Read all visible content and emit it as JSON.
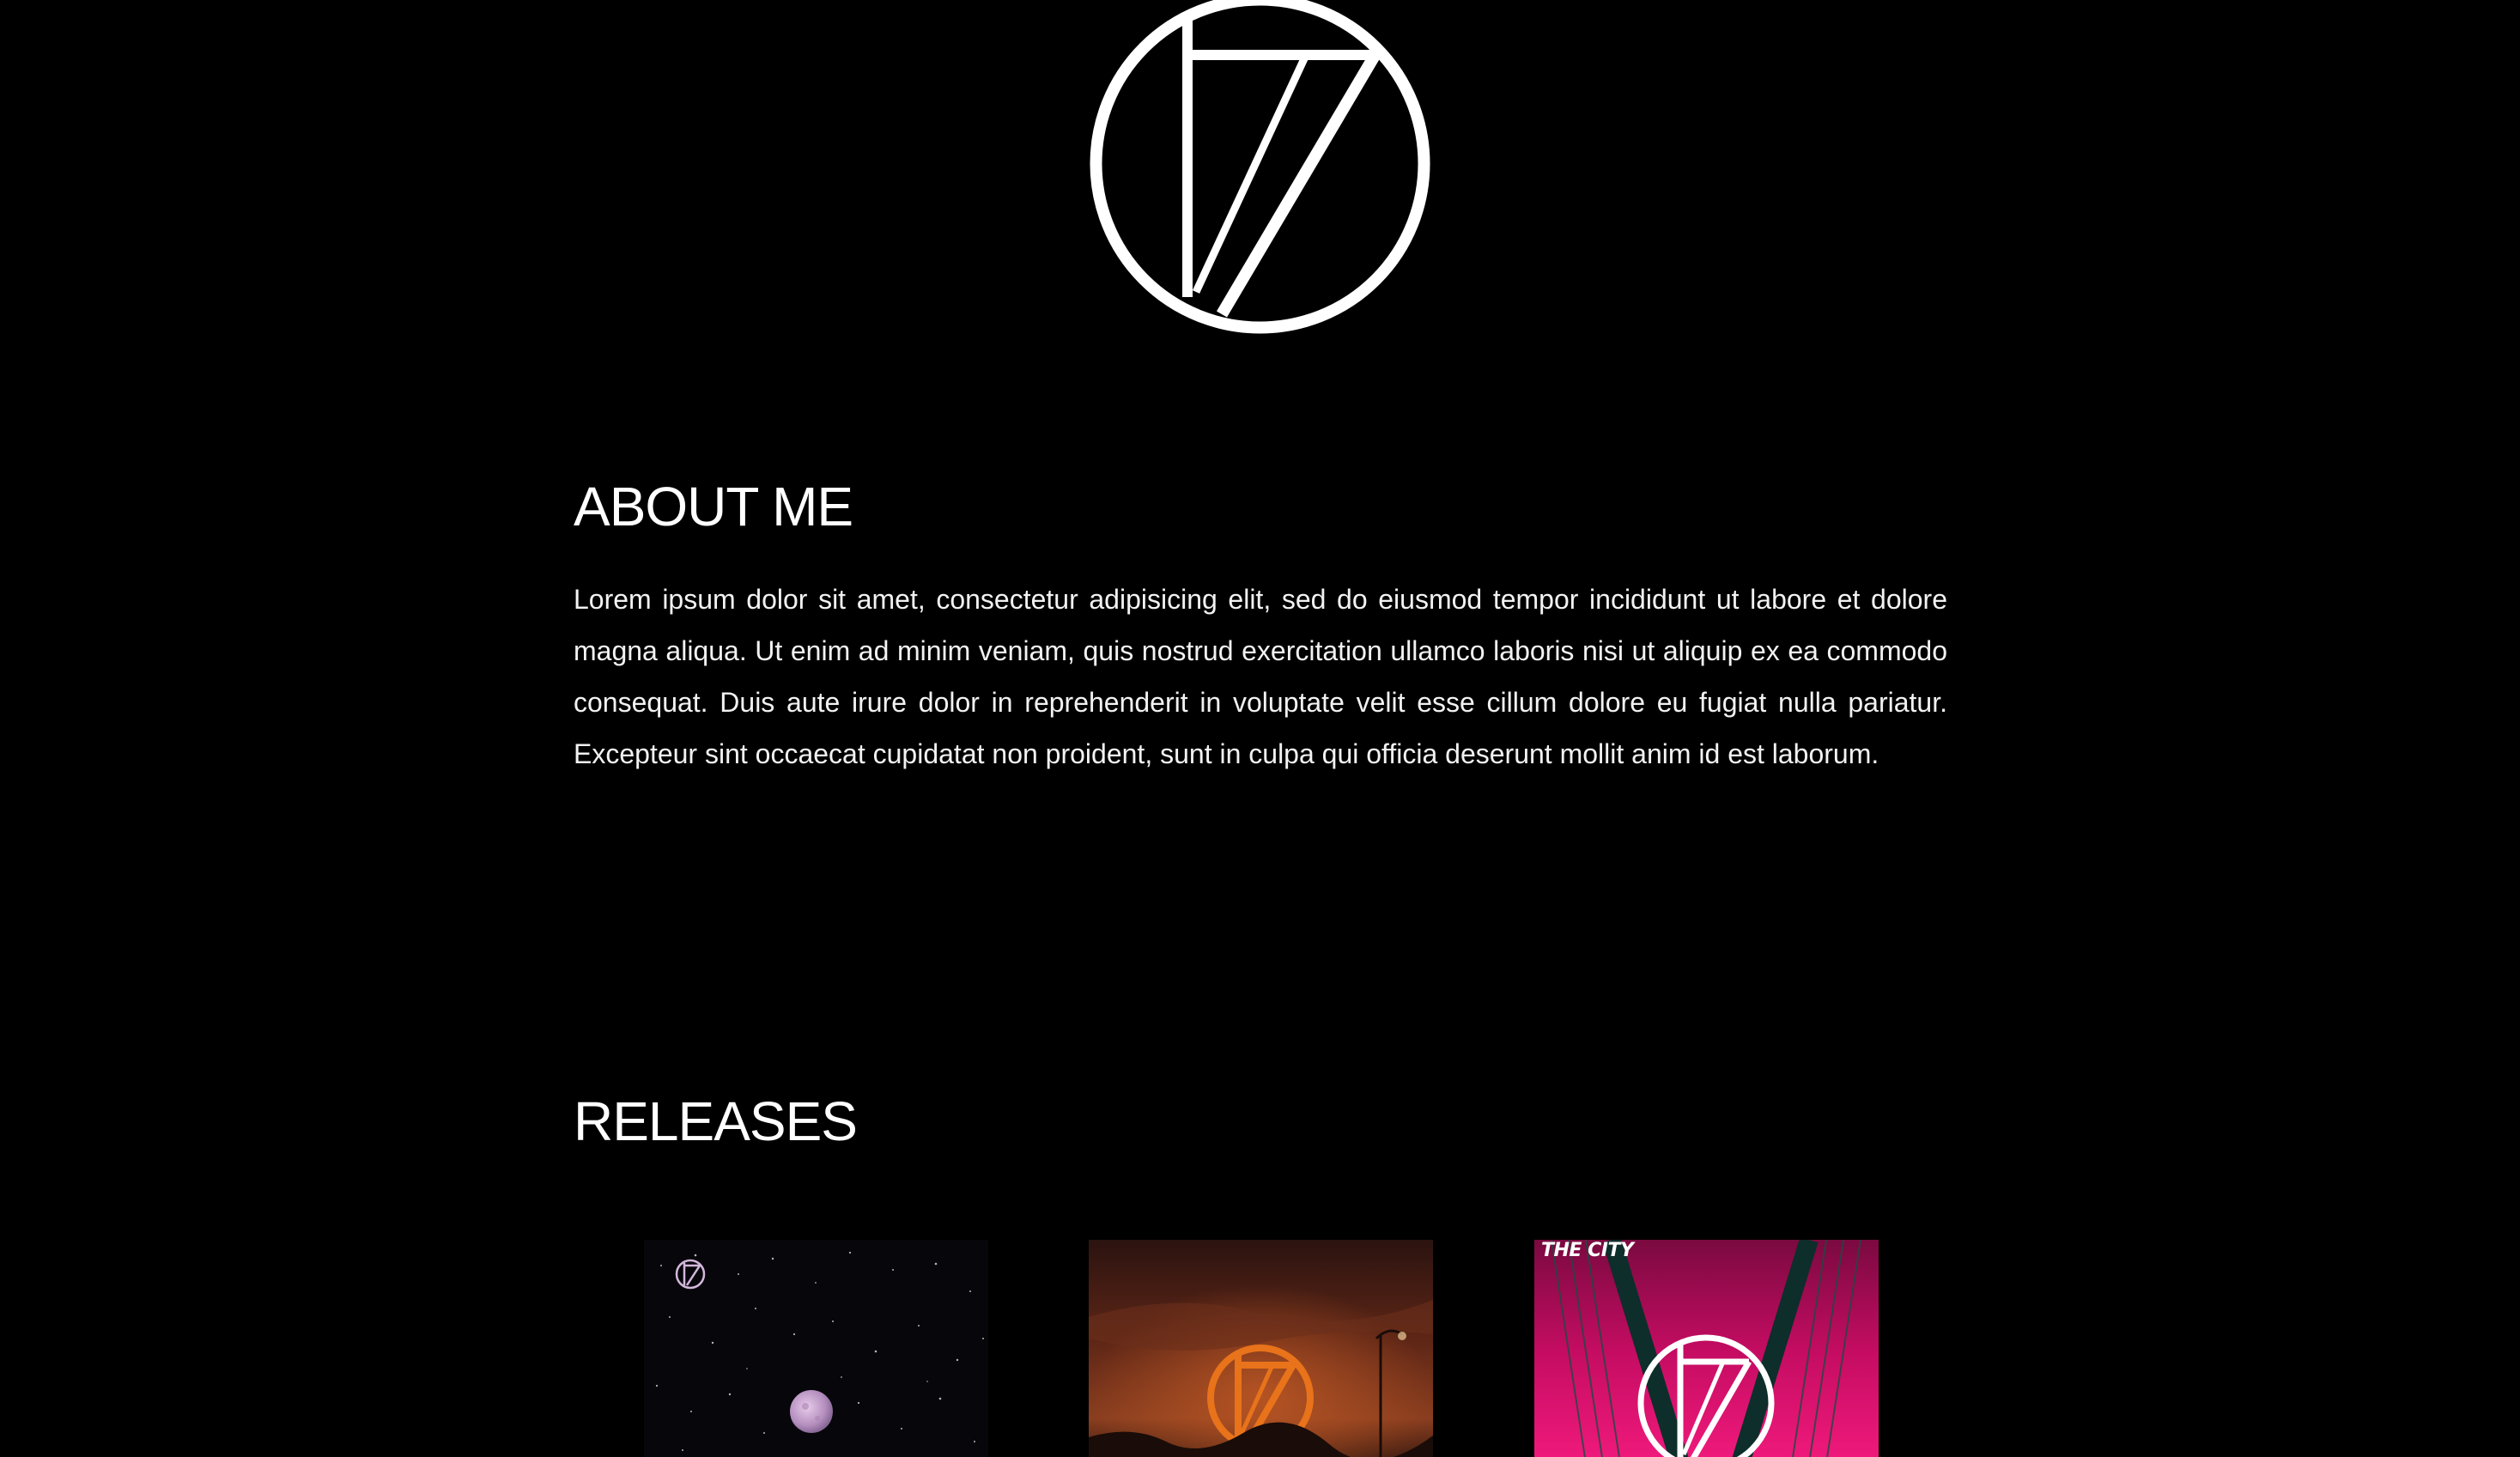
{
  "logo": {
    "icon": "circle-seventeen-logo"
  },
  "about": {
    "title": "ABOUT ME",
    "text": "Lorem ipsum dolor sit amet, consectetur adipisicing elit, sed do eiusmod tempor incididunt ut labore et dolore magna aliqua. Ut enim ad minim veniam, quis nostrud exercitation ullamco laboris nisi ut aliquip ex ea commodo consequat. Duis aute irure dolor in reprehenderit in voluptate velit esse cillum dolore eu fugiat nulla pariatur. Excepteur sint occaecat cupidatat non proident, sunt in culpa qui officia deserunt mollit anim id est laborum."
  },
  "releases": {
    "title": "RELEASES",
    "items": [
      {
        "cover_text": "",
        "theme": "space-moon",
        "accent": "#c9a2d6"
      },
      {
        "cover_text": "",
        "theme": "sunset-orange",
        "accent": "#e8731a"
      },
      {
        "cover_text": "THE CITY",
        "theme": "pink-bridge",
        "accent": "#e0107a"
      }
    ]
  }
}
